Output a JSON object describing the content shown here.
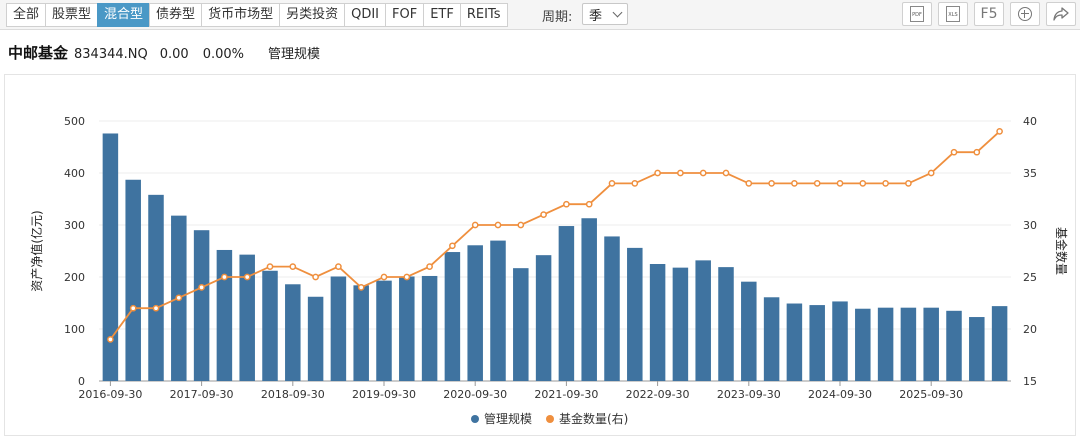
{
  "toolbar": {
    "tabs": [
      {
        "label": "全部",
        "active": false
      },
      {
        "label": "股票型",
        "active": false
      },
      {
        "label": "混合型",
        "active": true
      },
      {
        "label": "债券型",
        "active": false
      },
      {
        "label": "货币市场型",
        "active": false
      },
      {
        "label": "另类投资",
        "active": false
      },
      {
        "label": "QDII",
        "active": false
      },
      {
        "label": "FOF",
        "active": false
      },
      {
        "label": "ETF",
        "active": false
      },
      {
        "label": "REITs",
        "active": false
      }
    ],
    "period_label": "周期:",
    "period_value": "季",
    "tools": {
      "pdf": "PDF",
      "xls": "XLS",
      "f5": "F5"
    }
  },
  "header": {
    "name": "中邮基金",
    "code": "834344.NQ",
    "value": "0.00",
    "change": "0.00%",
    "metric": "管理规模"
  },
  "colors": {
    "bar": "#3f73a0",
    "line": "#ef8f3e",
    "active_tab": "#4a98c6"
  },
  "chart_data": {
    "type": "bar",
    "ylabel": "资产净值(亿元)",
    "y2label": "基金数量",
    "ylim": [
      0,
      500
    ],
    "y2lim": [
      15,
      40
    ],
    "yticks": [
      0,
      100,
      200,
      300,
      400,
      500
    ],
    "y2ticks": [
      15,
      20,
      25,
      30,
      35,
      40
    ],
    "xtick_labels": [
      "2016-09-30",
      "2017-09-30",
      "2018-09-30",
      "2019-09-30",
      "2020-09-30",
      "2021-09-30",
      "2022-09-30",
      "2023-09-30",
      "2024-09-30",
      "2025-09-30"
    ],
    "xtick_every": 4,
    "legend_position": "bottom",
    "series": [
      {
        "name": "管理规模",
        "type": "bar",
        "axis": "left",
        "values": [
          476,
          387,
          358,
          318,
          290,
          252,
          243,
          212,
          186,
          162,
          201,
          184,
          193,
          201,
          202,
          248,
          261,
          270,
          217,
          242,
          298,
          313,
          278,
          256,
          225,
          218,
          232,
          219,
          191,
          161,
          149,
          146,
          153,
          139,
          141,
          141,
          141,
          135,
          123,
          144
        ]
      },
      {
        "name": "基金数量(右)",
        "type": "line",
        "axis": "right",
        "values": [
          19,
          22,
          22,
          23,
          24,
          25,
          25,
          26,
          26,
          25,
          26,
          24,
          25,
          25,
          26,
          28,
          30,
          30,
          30,
          31,
          32,
          32,
          34,
          34,
          35,
          35,
          35,
          35,
          34,
          34,
          34,
          34,
          34,
          34,
          34,
          34,
          35,
          37,
          37,
          39
        ]
      }
    ]
  }
}
